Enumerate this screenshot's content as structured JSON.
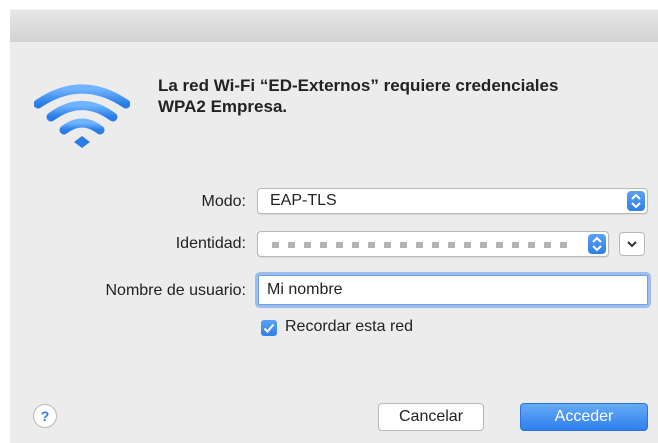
{
  "dialog": {
    "message": "La red Wi-Fi “ED-Externos” requiere credenciales\nWPA2 Empresa.",
    "icon": "wifi-icon",
    "accent_color": "#2f7fe8"
  },
  "form": {
    "modo": {
      "label": "Modo:",
      "value": "EAP-TLS"
    },
    "identidad": {
      "label": "Identidad:",
      "value": ""
    },
    "usuario": {
      "label": "Nombre de usuario:",
      "value": "Mi nombre"
    },
    "recordar": {
      "label": "Recordar esta red",
      "checked": true
    }
  },
  "buttons": {
    "help": "?",
    "cancel": "Cancelar",
    "accept": "Acceder"
  }
}
